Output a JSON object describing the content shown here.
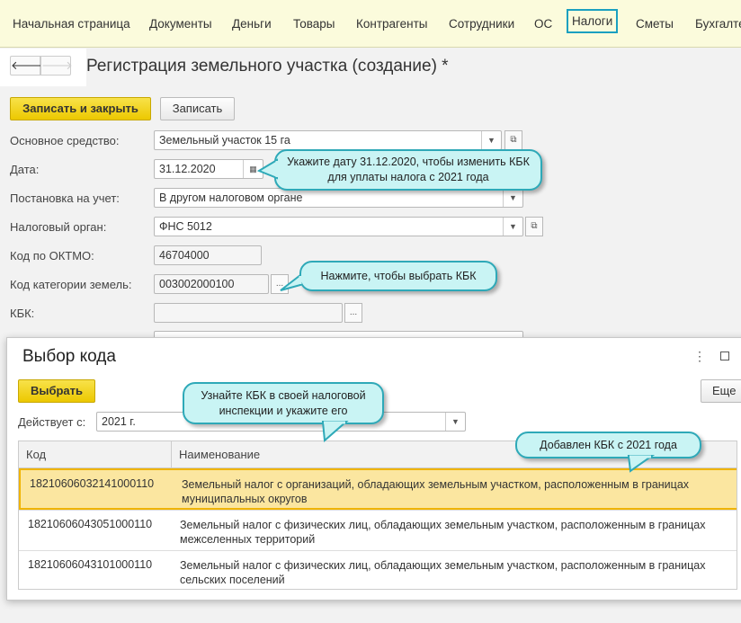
{
  "nav": {
    "items": [
      "Начальная страница",
      "Документы",
      "Деньги",
      "Товары",
      "Контрагенты",
      "Сотрудники",
      "ОС",
      "Налоги",
      "Сметы",
      "Бухгалте"
    ],
    "active": "Налоги"
  },
  "form": {
    "title": "Регистрация земельного участка (создание) *",
    "save_close": "Записать и закрыть",
    "save": "Записать",
    "fields": [
      {
        "label": "Основное средство:",
        "value": "Земельный участок 15 га"
      },
      {
        "label": "Дата:",
        "value": "31.12.2020"
      },
      {
        "label": "Постановка на учет:",
        "value": "В другом налоговом органе"
      },
      {
        "label": "Налоговый орган:",
        "value": "ФНС 5012"
      },
      {
        "label": "Код по ОКТМО:",
        "value": "46704000"
      },
      {
        "label": "Код категории земель:",
        "value": "003002000100"
      },
      {
        "label": "КБК:",
        "value": ""
      }
    ]
  },
  "callouts": {
    "date": "Укажите дату 31.12.2020, чтобы изменить КБК для уплаты налога с 2021 года",
    "kbk": "Нажмите, чтобы выбрать КБК",
    "inspect": "Узнайте КБК в своей налоговой инспекции и укажите его",
    "added": "Добавлен КБК с 2021 года"
  },
  "dialog": {
    "title": "Выбор кода",
    "select": "Выбрать",
    "more": "Еще",
    "valid_label": "Действует с:",
    "valid_value": "2021 г.",
    "columns": [
      "Код",
      "Наименование"
    ],
    "rows": [
      {
        "code": "18210606032141000110",
        "name": "Земельный налог с организаций, обладающих земельным участком, расположенным в границах муниципальных округов",
        "selected": true
      },
      {
        "code": "18210606043051000110",
        "name": "Земельный налог с физических лиц, обладающих земельным участком, расположенным в границах межселенных территорий"
      },
      {
        "code": "18210606043101000110",
        "name": "Земельный налог с физических лиц, обладающих земельным участком, расположенным в границах сельских поселений"
      }
    ]
  },
  "colors": {
    "accent": "#1aa0c0",
    "primary_button": "#f0cf10",
    "callout_bg": "#c9f4f4",
    "selected_row": "#fbe6a0"
  }
}
